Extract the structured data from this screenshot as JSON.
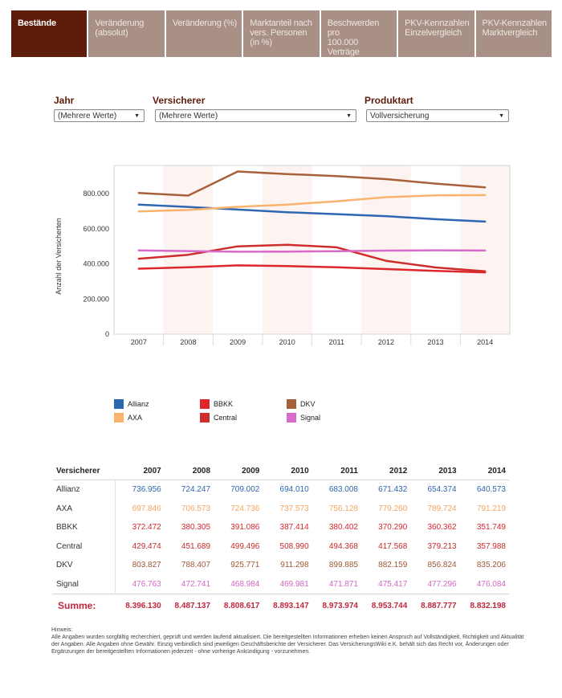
{
  "tabs": [
    {
      "label1": "Bestände",
      "label2": "",
      "label3": "",
      "active": true
    },
    {
      "label1": "Veränderung",
      "label2": "(absolut)",
      "label3": "",
      "active": false
    },
    {
      "label1": "Veränderung (%)",
      "label2": "",
      "label3": "",
      "active": false
    },
    {
      "label1": "Marktanteil  nach",
      "label2": "vers. Personen",
      "label3": "(in %)",
      "active": false
    },
    {
      "label1": "Beschwerden pro",
      "label2": "100.000 Verträge",
      "label3": "",
      "active": false
    },
    {
      "label1": "PKV-Kennzahlen",
      "label2": "Einzelvergleich",
      "label3": "",
      "active": false
    },
    {
      "label1": "PKV-Kennzahlen",
      "label2": "Marktvergleich",
      "label3": "",
      "active": false
    }
  ],
  "filters": {
    "year": {
      "label": "Jahr",
      "value": "(Mehrere Werte)"
    },
    "insurer": {
      "label": "Versicherer",
      "value": "(Mehrere Werte)"
    },
    "product": {
      "label": "Produktart",
      "value": "Vollversicherung"
    }
  },
  "chart_data": {
    "type": "line",
    "ylabel": "Anzahl der Versicherten",
    "xlabel": "",
    "categories": [
      "2007",
      "2008",
      "2009",
      "2010",
      "2011",
      "2012",
      "2013",
      "2014"
    ],
    "ylim": [
      0,
      960000
    ],
    "yticks": [
      0,
      200000,
      400000,
      600000,
      800000
    ],
    "ytick_labels": [
      "0",
      "200.000",
      "400.000",
      "600.000",
      "800.000"
    ],
    "grid": false,
    "band_color": "#fdf3f1",
    "legend_position": "bottom",
    "series": [
      {
        "name": "Allianz",
        "color": "#2e67b1",
        "values": [
          736956,
          724247,
          709002,
          694010,
          683008,
          671432,
          654374,
          640573
        ]
      },
      {
        "name": "AXA",
        "color": "#f9b36f",
        "values": [
          697846,
          706573,
          724736,
          737573,
          756128,
          779260,
          789724,
          791219
        ]
      },
      {
        "name": "BBKK",
        "color": "#e0262d",
        "values": [
          372472,
          380305,
          391086,
          387414,
          380402,
          370290,
          360362,
          351749
        ]
      },
      {
        "name": "Central",
        "color": "#cf2d2d",
        "values": [
          429474,
          451689,
          499496,
          508990,
          494368,
          417568,
          379213,
          357988
        ]
      },
      {
        "name": "DKV",
        "color": "#a8603b",
        "values": [
          803827,
          788407,
          925771,
          911298,
          899885,
          882159,
          856824,
          835206
        ]
      },
      {
        "name": "Signal",
        "color": "#d86ac9",
        "values": [
          476763,
          472741,
          468984,
          469981,
          471871,
          475417,
          477296,
          476084
        ]
      }
    ]
  },
  "table": {
    "header_label": "Versicherer",
    "years": [
      "2007",
      "2008",
      "2009",
      "2010",
      "2011",
      "2012",
      "2013",
      "2014"
    ],
    "rows": [
      {
        "name": "Allianz",
        "color": "#2e67b1",
        "values": [
          "736.956",
          "724.247",
          "709.002",
          "694.010",
          "683.008",
          "671.432",
          "654.374",
          "640.573"
        ]
      },
      {
        "name": "AXA",
        "color": "#f5a55e",
        "values": [
          "697.846",
          "706.573",
          "724.736",
          "737.573",
          "756.128",
          "779.260",
          "789.724",
          "791.219"
        ]
      },
      {
        "name": "BBKK",
        "color": "#d9262e",
        "values": [
          "372.472",
          "380.305",
          "391.086",
          "387.414",
          "380.402",
          "370.290",
          "360.362",
          "351.749"
        ]
      },
      {
        "name": "Central",
        "color": "#c82b2b",
        "values": [
          "429.474",
          "451.689",
          "499.496",
          "508.990",
          "494.368",
          "417.568",
          "379.213",
          "357.988"
        ]
      },
      {
        "name": "DKV",
        "color": "#9e5a35",
        "values": [
          "803.827",
          "788.407",
          "925.771",
          "911.298",
          "899.885",
          "882.159",
          "856.824",
          "835.206"
        ]
      },
      {
        "name": "Signal",
        "color": "#d367c4",
        "values": [
          "476.763",
          "472.741",
          "468.984",
          "469.981",
          "471.871",
          "475.417",
          "477.296",
          "476.084"
        ]
      }
    ],
    "sum_label": "Summe:",
    "sums": [
      "8.396.130",
      "8.487.137",
      "8.808.617",
      "8.893.147",
      "8.973.974",
      "8.953.744",
      "8.887.777",
      "8.832.198"
    ]
  },
  "note": {
    "title": "Hinweis:",
    "text": "Alle Angaben wurden sorgfältig recherchiert, geprüft und werden laufend aktualisiert. Die bereitgestellten Informationen erheben keinen Anspruch auf Vollständigkeit, Richtigkeit und Aktualität der Angaben. Alle Angaben ohne Gewähr. Einzig verbindlich sind jeweiligen Geschäftsberichte der Versicherer. Das VersicherungsWiki e.K. behält sich das Recht vor, Änderungen oder Ergänzungen der bereitgestellten Informationen jederzeit - ohne vorherige Ankündigung - vorzunehmen."
  }
}
